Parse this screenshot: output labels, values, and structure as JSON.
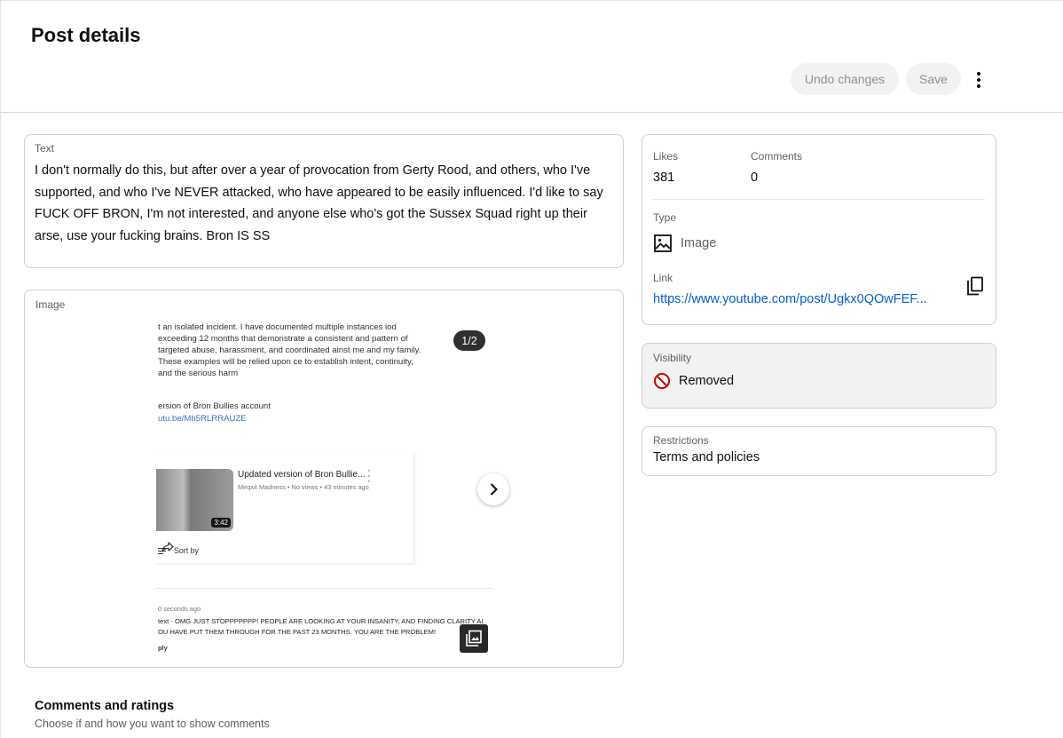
{
  "header": {
    "title": "Post details",
    "undo_label": "Undo changes",
    "save_label": "Save"
  },
  "text_section": {
    "label": "Text",
    "body": "I don't normally do this, but after over a year of provocation from Gerty Rood, and others, who I've supported, and who I've NEVER attacked, who have appeared to be easily influenced.  I'd like to say FUCK OFF BRON, I'm not interested, and anyone else who's got the Sussex Squad right up their arse, use your fucking brains.  Bron IS SS"
  },
  "image_section": {
    "label": "Image",
    "counter": "1/2",
    "screenshot": {
      "paragraph": "t an isolated incident. I have documented multiple instances iod exceeding 12 months that demonstrate a consistent and pattern of targeted abuse, harassment, and coordinated ainst me and my family. These examples will be relied upon ce to establish intent, continuity, and the serious harm",
      "subheading": "ersion of Bron Bullies account",
      "url": "utu.be/Mh5RLRRAUZE",
      "video_title": "Updated version of Bron Bullie...",
      "video_meta": "Meqxit Madness • No views • 43 minutes ago",
      "video_duration": "3:42",
      "sort_label": "Sort by",
      "comment_time": "0 seconds ago",
      "comment_line1": "text - OMG JUST STOPPPPPPP!  PEOPLE ARE LOOKING AT YOUR INSANITY, AND FINDING CLARITY AI",
      "comment_line2": "OU HAVE PUT THEM THROUGH FOR THE PAST 23 MONTHS.  YOU ARE THE PROBLEM!",
      "reply_label": "ply"
    }
  },
  "stats": {
    "likes_label": "Likes",
    "likes_value": "381",
    "comments_label": "Comments",
    "comments_value": "0",
    "type_label": "Type",
    "type_value": "Image",
    "link_label": "Link",
    "link_value": "https://www.youtube.com/post/Ugkx0QOwFEF..."
  },
  "visibility": {
    "label": "Visibility",
    "value": "Removed",
    "status_color": "#cc0000"
  },
  "restrictions": {
    "label": "Restrictions",
    "value": "Terms and policies"
  },
  "comments_section": {
    "heading": "Comments and ratings",
    "subtext": "Choose if and how you want to show comments"
  },
  "icons": {
    "more": "more-vert-icon",
    "image": "image-icon",
    "copy": "copy-icon",
    "removed": "block-icon",
    "next": "chevron-right-icon",
    "gallery": "image-gallery-icon",
    "share": "share-icon",
    "sort": "sort-icon"
  },
  "colors": {
    "link": "#065fd4",
    "disabled_pill_bg": "#f2f2f2",
    "disabled_pill_text": "#909090",
    "visibility_bg": "#f2f2f2"
  }
}
